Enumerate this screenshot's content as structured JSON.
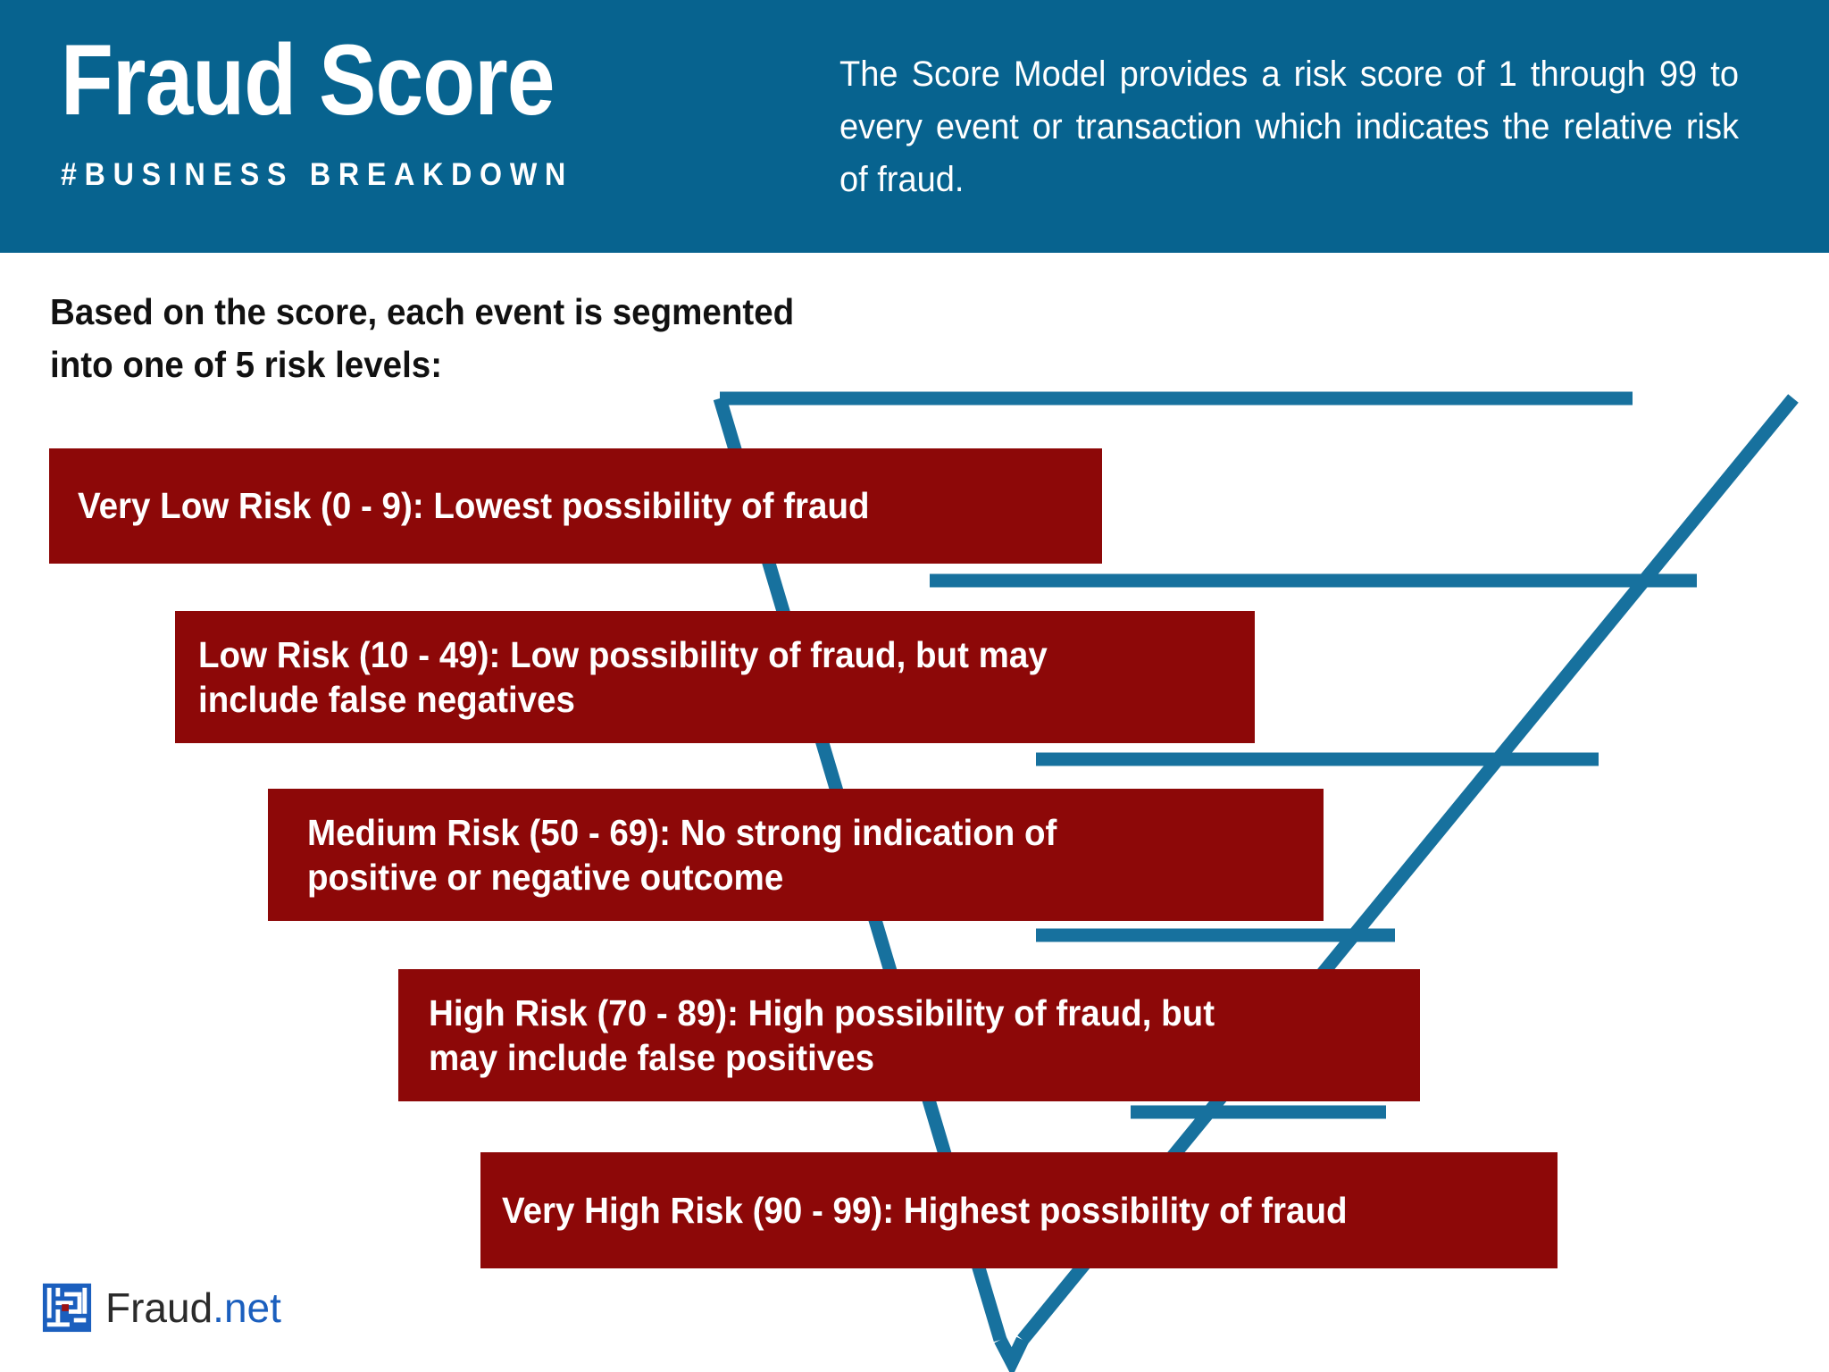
{
  "header": {
    "title": "Fraud Score",
    "subtitle": "#BUSINESS BREAKDOWN",
    "description": "The Score Model provides a risk score of 1 through 99 to every event or transaction which indicates the relative risk of fraud.",
    "bg_color": "#07638f",
    "text_color": "#ffffff"
  },
  "intro": {
    "text": "Based on the score, each event is segmented\ninto one of 5 risk levels:"
  },
  "chart_data": {
    "type": "funnel",
    "title": "Fraud Score Risk Level Funnel",
    "accent_color": "#07638f",
    "band_color": "#8d0808",
    "label_color": "#ffffff",
    "score_range": [
      1,
      99
    ],
    "level_count": 5,
    "categories": [
      "Very Low Risk",
      "Low Risk",
      "Medium Risk",
      "High Risk",
      "Very High Risk"
    ],
    "score_bands": [
      "0 - 9",
      "10 - 49",
      "50 - 69",
      "70 - 89",
      "90 - 99"
    ],
    "values": [
      9,
      49,
      69,
      89,
      99
    ],
    "descriptions": [
      "Lowest possibility of fraud",
      "Low possibility of fraud, but may include false negatives",
      "No strong indication of positive or negative outcome",
      "High possibility of fraud, but may include false positives",
      "Highest possibility of fraud"
    ],
    "labels": [
      "Very Low Risk (0 - 9): Lowest possibility of fraud",
      "Low Risk (10 - 49): Low possibility of fraud, but may\ninclude false negatives",
      "Medium Risk (50 - 69): No strong indication of\npositive or negative outcome",
      "High Risk (70 - 89): High possibility of fraud, but\nmay include false positives",
      "Very High Risk (90 - 99): Highest possibility of fraud"
    ]
  },
  "logo": {
    "name": "Fraud",
    "tld": ".net",
    "mark": "maze-icon",
    "mark_color": "#1b5fbe",
    "accent_color": "#1b5fbe"
  }
}
